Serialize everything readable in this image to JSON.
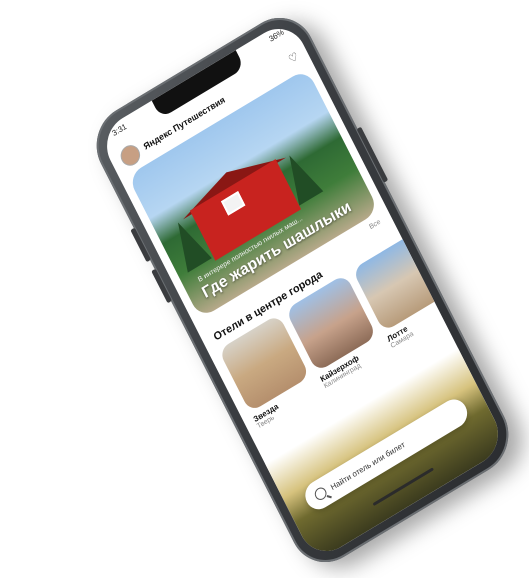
{
  "status": {
    "time": "3:31",
    "battery": "36%"
  },
  "app": {
    "title": "Яндекс Путешествия"
  },
  "hero": {
    "subtitle": "В интерере полностью гнилых маш...",
    "title": "Где жарить шашлыки"
  },
  "section": {
    "title": "Отели в центре города",
    "all_link": "Все"
  },
  "hotels": [
    {
      "name": "Звезда",
      "city": "Тверь"
    },
    {
      "name": "Кайзерхоф",
      "city": "Калининград"
    },
    {
      "name": "Лотте",
      "city": "Самара"
    }
  ],
  "search": {
    "placeholder": "Найти отель или билет"
  },
  "colors": {
    "accent": "#c8231f"
  }
}
